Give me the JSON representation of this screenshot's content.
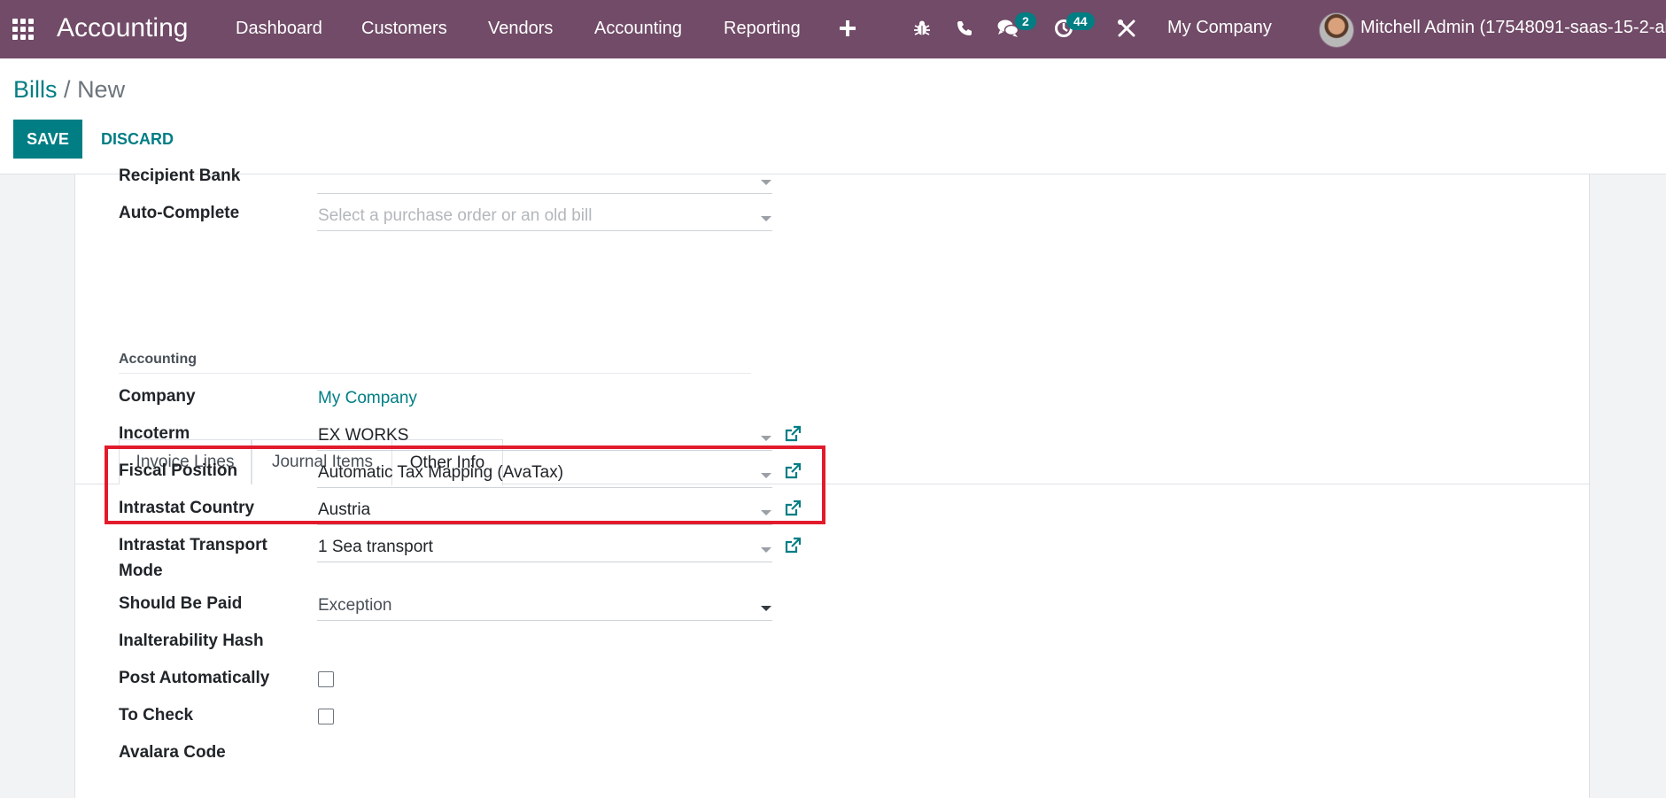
{
  "navbar": {
    "app_title": "Accounting",
    "menu": [
      "Dashboard",
      "Customers",
      "Vendors",
      "Accounting",
      "Reporting"
    ],
    "messages_badge": "2",
    "activities_badge": "44",
    "company": "My Company",
    "user": "Mitchell Admin (17548091-saas-15-2-all"
  },
  "breadcrumb": {
    "parent": "Bills",
    "separator": "/",
    "current": "New"
  },
  "actions": {
    "save": "SAVE",
    "discard": "DISCARD"
  },
  "top_fields": {
    "recipient_bank_label": "Recipient Bank",
    "auto_complete_label": "Auto-Complete",
    "auto_complete_placeholder": "Select a purchase order or an old bill"
  },
  "tabs": [
    {
      "label": "Invoice Lines",
      "active": false
    },
    {
      "label": "Journal Items",
      "active": false
    },
    {
      "label": "Other Info",
      "active": true
    }
  ],
  "other_info": {
    "group_title": "Accounting",
    "company_label": "Company",
    "company_value": "My Company",
    "incoterm_label": "Incoterm",
    "incoterm_value": "EX WORKS",
    "fiscal_position_label": "Fiscal Position",
    "fiscal_position_value": "Automatic Tax Mapping (AvaTax)",
    "intrastat_country_label": "Intrastat Country",
    "intrastat_country_value": "Austria",
    "transport_mode_label_1": "Intrastat Transport",
    "transport_mode_label_2": "Mode",
    "transport_mode_value": "1 Sea transport",
    "should_be_paid_label": "Should Be Paid",
    "should_be_paid_value": "Exception",
    "inalterability_hash_label": "Inalterability Hash",
    "post_automatically_label": "Post Automatically",
    "post_automatically_checked": false,
    "to_check_label": "To Check",
    "to_check_checked": false,
    "avalara_code_label": "Avalara Code"
  },
  "colors": {
    "navbar": "#714b67",
    "accent": "#017e84",
    "highlight": "#e21b2c"
  }
}
